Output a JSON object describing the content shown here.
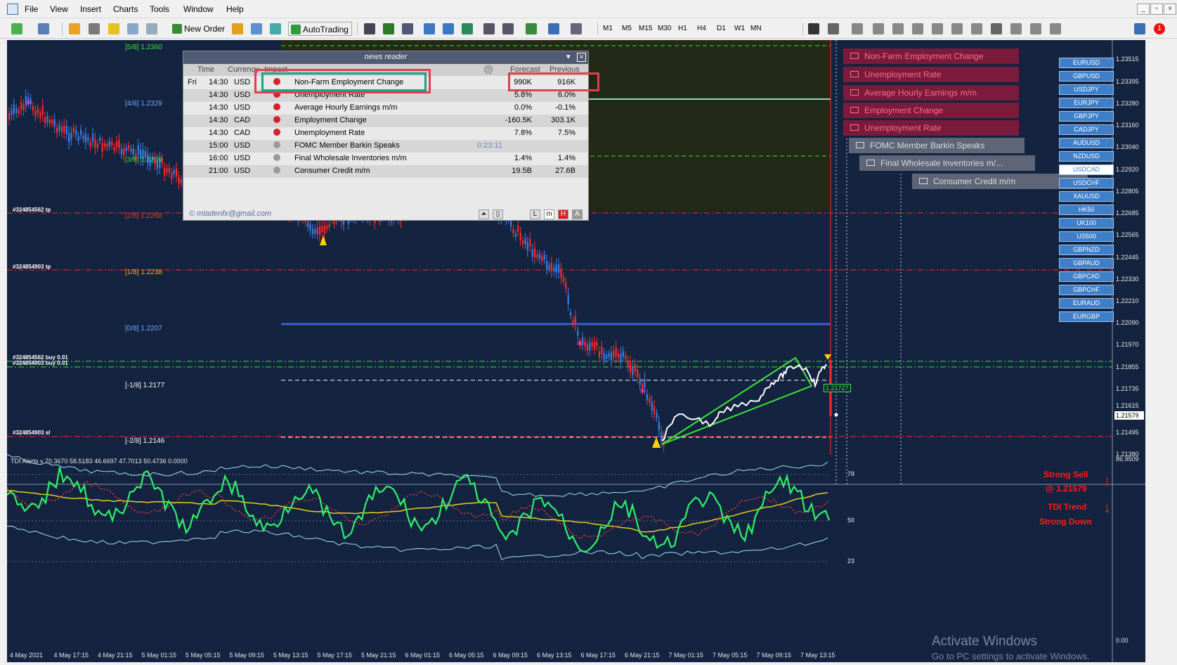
{
  "menu": [
    "File",
    "View",
    "Insert",
    "Charts",
    "Tools",
    "Window",
    "Help"
  ],
  "toolbar": {
    "new_order": "New Order",
    "autotrading": "AutoTrading",
    "timeframes": [
      "M1",
      "M5",
      "M15",
      "M30",
      "H1",
      "H4",
      "D1",
      "W1",
      "MN"
    ],
    "notification_count": "1"
  },
  "chart": {
    "price_axis": [
      "1.23515",
      "1.23395",
      "1.23280",
      "1.23160",
      "1.23040",
      "1.22920",
      "1.22805",
      "1.22685",
      "1.22565",
      "1.22445",
      "1.22330",
      "1.22210",
      "1.22090",
      "1.21970",
      "1.21855",
      "1.21735",
      "1.21615",
      "1.21579",
      "1.21495",
      "1.21380"
    ],
    "time_axis": [
      "4 May 2021",
      "4 May 17:15",
      "4 May 21:15",
      "5 May 01:15",
      "5 May 05:15",
      "5 May 09:15",
      "5 May 13:15",
      "5 May 17:15",
      "5 May 21:15",
      "6 May 01:15",
      "6 May 05:15",
      "6 May 09:15",
      "6 May 13:15",
      "6 May 17:15",
      "6 May 21:15",
      "7 May 01:15",
      "7 May 05:15",
      "7 May 09:15",
      "7 May 13:15"
    ],
    "murrey": [
      {
        "label": "[5/8]",
        "value": "1.2360",
        "color": "#3ddc3d"
      },
      {
        "label": "[4/8]",
        "value": "1.2329",
        "color": "#6fa6ff"
      },
      {
        "label": "[3/8]",
        "value": "1.2299",
        "color": "#3ddc3d"
      },
      {
        "label": "[2/8]",
        "value": "1.2268",
        "color": "#ff2a2a"
      },
      {
        "label": "[1/8]",
        "value": "1.2238",
        "color": "#ffb000"
      },
      {
        "label": "[0/8]",
        "value": "1.2207",
        "color": "#6fa6ff"
      },
      {
        "label": "[-1/8]",
        "value": "1.2177",
        "color": "#ffffff"
      },
      {
        "label": "[-2/8]",
        "value": "1.2146",
        "color": "#ffffff"
      }
    ],
    "orders": [
      "#324854562 tp",
      "#324854903 tp",
      "#324854562 buy 0.01",
      "#324854903 buy 0.01",
      "#324854903 sl"
    ],
    "price_tag": "1.21727",
    "current_price": "1.21579"
  },
  "news": {
    "title": "news reader",
    "headers": [
      "Time",
      "Currency",
      "Impact",
      "Forecast",
      "Previous"
    ],
    "rows": [
      {
        "day": "Fri",
        "time": "14:30",
        "cur": "USD",
        "impact": "high",
        "event": "Non-Farm Employment Change",
        "countdown": "",
        "forecast": "990K",
        "previous": "916K"
      },
      {
        "day": "",
        "time": "14:30",
        "cur": "USD",
        "impact": "high",
        "event": "Unemployment Rate",
        "countdown": "",
        "forecast": "5.8%",
        "previous": "6.0%"
      },
      {
        "day": "",
        "time": "14:30",
        "cur": "USD",
        "impact": "high",
        "event": "Average Hourly Earnings m/m",
        "countdown": "",
        "forecast": "0.0%",
        "previous": "-0.1%"
      },
      {
        "day": "",
        "time": "14:30",
        "cur": "CAD",
        "impact": "high",
        "event": "Employment Change",
        "countdown": "",
        "forecast": "-160.5K",
        "previous": "303.1K"
      },
      {
        "day": "",
        "time": "14:30",
        "cur": "CAD",
        "impact": "high",
        "event": "Unemployment Rate",
        "countdown": "",
        "forecast": "7.8%",
        "previous": "7.5%"
      },
      {
        "day": "",
        "time": "15:00",
        "cur": "USD",
        "impact": "low",
        "event": "FOMC Member Barkin Speaks",
        "countdown": "0:23:11",
        "forecast": "",
        "previous": ""
      },
      {
        "day": "",
        "time": "16:00",
        "cur": "USD",
        "impact": "low",
        "event": "Final Wholesale Inventories m/m",
        "countdown": "",
        "forecast": "1.4%",
        "previous": "1.4%"
      },
      {
        "day": "",
        "time": "21:00",
        "cur": "USD",
        "impact": "low",
        "event": "Consumer Credit m/m",
        "countdown": "",
        "forecast": "19.5B",
        "previous": "27.6B"
      }
    ],
    "footer_email": "© mladenfx@gmail.com",
    "buttons": [
      "L",
      "m",
      "H",
      "A"
    ]
  },
  "events": [
    "Non-Farm Employment Change",
    "Unemployment Rate",
    "Average Hourly Earnings m/m",
    "Employment Change",
    "Unemployment Rate",
    "FOMC Member Barkin Speaks",
    "Final Wholesale Inventories m/...",
    "Consumer Credit m/m"
  ],
  "symbols": [
    "EURUSD",
    "GBPUSD",
    "USDJPY",
    "EURJPY",
    "GBPJPY",
    "CADJPY",
    "AUDUSD",
    "NZDUSD",
    "USDCAD",
    "USDCHF",
    "XAUUSD",
    "HK50",
    "UK100",
    "US500",
    "GBPNZD",
    "GBPAUD",
    "GBPCAD",
    "GBPCHF",
    "EURAUD",
    "EURGBP"
  ],
  "selected_symbol": "USDCAD",
  "tdi": {
    "header": "TDI Alerts v 70.3670 58.5183 46.6697 47.7013 50.4736 0.0000",
    "levels": [
      "78",
      "50",
      "23"
    ],
    "axis_top": "86.9509",
    "axis_bottom": "0.00",
    "signal1": "Strong Sell",
    "signal1_price": "@ 1.21579",
    "signal2": "TDI Trend",
    "signal2_sub": "Strong Down"
  },
  "watermark": {
    "line1": "Activate Windows",
    "line2": "Go to PC settings to activate Windows."
  }
}
